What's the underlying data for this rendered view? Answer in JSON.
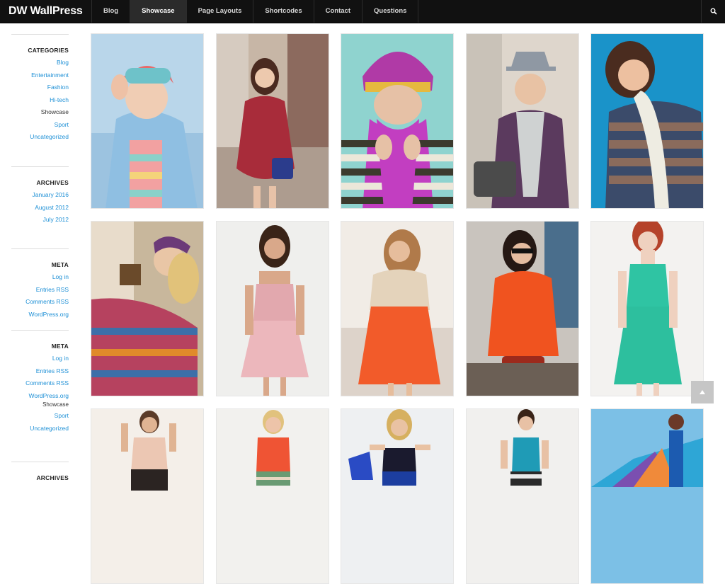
{
  "header": {
    "logo": "DW WallPress",
    "nav": [
      "Blog",
      "Showcase",
      "Page Layouts",
      "Shortcodes",
      "Contact",
      "Questions"
    ],
    "active": "Showcase"
  },
  "sidebar": {
    "categories": {
      "title": "CATEGORIES",
      "items": [
        "Blog",
        "Entertainment",
        "Fashion",
        "Hi-tech",
        "Showcase",
        "Sport",
        "Uncategorized"
      ]
    },
    "archives": {
      "title": "ARCHIVES",
      "items": [
        "January 2016",
        "August 2012",
        "July 2012"
      ]
    },
    "meta1": {
      "title": "META",
      "items": [
        "Log in",
        "Entries RSS",
        "Comments RSS",
        "WordPress.org"
      ]
    },
    "meta2": {
      "title": "META",
      "items": [
        "Log in",
        "Entries RSS",
        "Comments RSS",
        "WordPress.org"
      ],
      "overflow_items": [
        "Showcase",
        "Sport",
        "Uncategorized"
      ]
    },
    "archives2": {
      "title": "ARCHIVES"
    }
  },
  "colors": {
    "link": "#1e90d6",
    "topbar": "#111111"
  },
  "icons": {
    "search": "search-icon",
    "back_to_top": "arrow-up-icon"
  }
}
